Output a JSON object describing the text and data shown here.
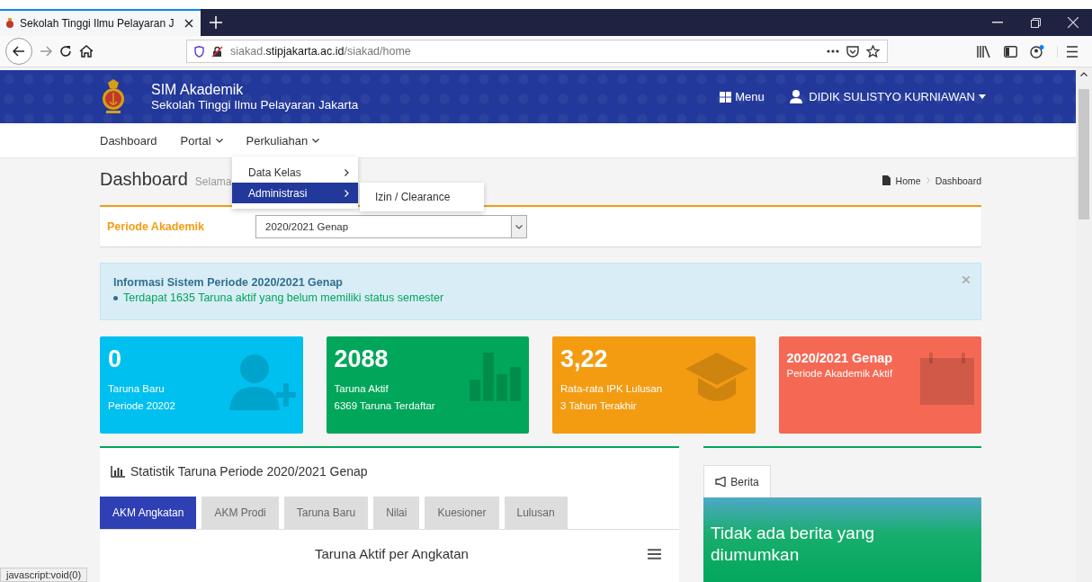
{
  "browser": {
    "tab_title": "Sekolah Tinggi Ilmu Pelayaran J",
    "url_prefix": "siakad.",
    "url_domain": "stipjakarta.ac.id",
    "url_path": "/siakad/home",
    "status_text": "javascript:void(0)"
  },
  "header": {
    "app_title": "SIM Akademik",
    "institution": "Sekolah Tinggi Ilmu Pelayaran Jakarta",
    "menu_label": "Menu",
    "user_name": "DIDIK SULISTYO KURNIAWAN"
  },
  "nav": [
    {
      "label": "Dashboard",
      "dropdown": false
    },
    {
      "label": "Portal",
      "dropdown": true
    },
    {
      "label": "Perkuliahan",
      "dropdown": true
    }
  ],
  "dropdown": {
    "items": [
      {
        "label": "Data Kelas",
        "selected": false
      },
      {
        "label": "Administrasi",
        "selected": true
      }
    ],
    "submenu": [
      "Izin / Clearance"
    ]
  },
  "page_title": "Dashboard",
  "page_subtitle": "Selama",
  "breadcrumbs": [
    "Home",
    "Dashboard"
  ],
  "period": {
    "label": "Periode Akademik",
    "value": "2020/2021 Genap"
  },
  "alert": {
    "title": "Informasi Sistem Periode 2020/2021 Genap",
    "message": "Terdapat 1635 Taruna aktif yang belum memiliki status semester"
  },
  "stat_cards": [
    {
      "kind": "users",
      "color": "#00c0ef",
      "value": "0",
      "line1": "Taruna Baru",
      "line2": "Periode 20202"
    },
    {
      "kind": "bars",
      "color": "#00a65a",
      "value": "2088",
      "line1": "Taruna Aktif",
      "line2": "6369 Taruna Terdaftar"
    },
    {
      "kind": "cap",
      "color": "#f39c12",
      "value": "3,22",
      "line1": "Rata-rata IPK Lulusan",
      "line2": "3 Tahun Terakhir"
    },
    {
      "kind": "calendar",
      "color": "#f56954",
      "value": "2020/2021 Genap",
      "line1": "Periode Akademik Aktif"
    }
  ],
  "stats_panel": {
    "title": "Statistik Taruna Periode 2020/2021 Genap",
    "tabs": [
      {
        "label": "AKM Angkatan",
        "selected": true
      },
      {
        "label": "AKM Prodi",
        "selected": false
      },
      {
        "label": "Taruna Baru",
        "selected": false
      },
      {
        "label": "Nilai",
        "selected": false
      },
      {
        "label": "Kuesioner",
        "selected": false
      },
      {
        "label": "Lulusan",
        "selected": false
      }
    ],
    "chart_title": "Taruna Aktif per Angkatan"
  },
  "news": {
    "tab_label": "Berita",
    "message": "Tidak ada berita yang diumumkan"
  }
}
